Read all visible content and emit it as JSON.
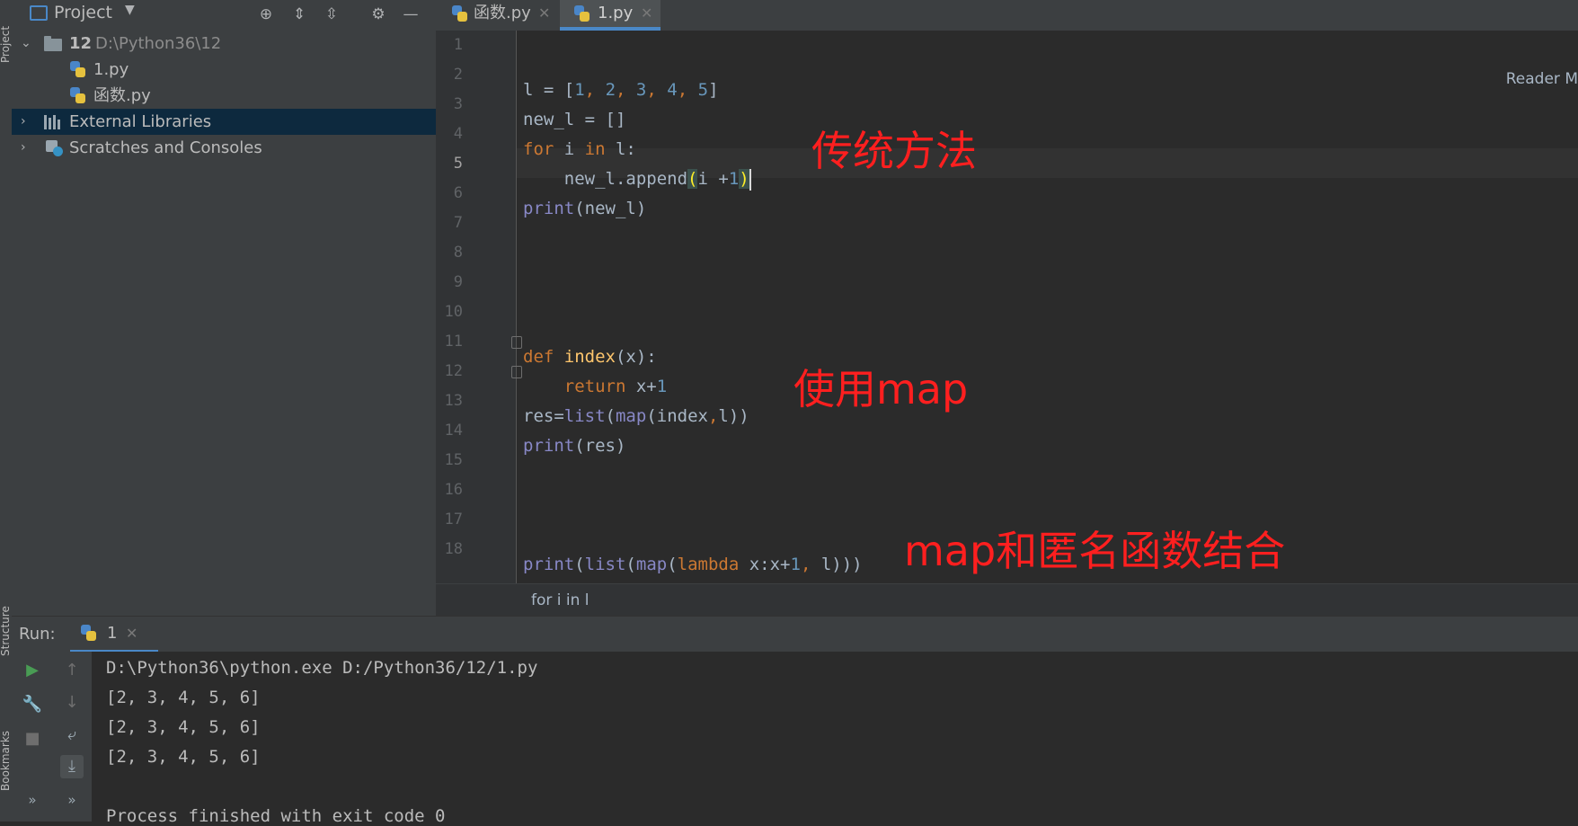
{
  "side_labels": {
    "project": "Project",
    "structure": "Structure",
    "bookmarks": "Bookmarks"
  },
  "project_panel": {
    "title": "Project",
    "tree": [
      {
        "name": "12",
        "path": "D:\\Python36\\12"
      },
      {
        "name": "1.py"
      },
      {
        "name": "函数.py"
      },
      {
        "name": "External Libraries"
      },
      {
        "name": "Scratches and Consoles"
      }
    ]
  },
  "tabs": [
    {
      "label": "函数.py",
      "active": false
    },
    {
      "label": "1.py",
      "active": true
    }
  ],
  "editor": {
    "reader_mode": "Reader M",
    "current_line": 5,
    "line_numbers": [
      "1",
      "2",
      "3",
      "4",
      "5",
      "6",
      "7",
      "8",
      "9",
      "10",
      "11",
      "12",
      "13",
      "14",
      "15",
      "16",
      "17",
      "18"
    ],
    "code_lines": [
      "",
      "l = [1, 2, 3, 4, 5]",
      "new_l = []",
      "for i in l:",
      "    new_l.append(i +1)",
      "print(new_l)",
      "",
      "",
      "",
      "",
      "def index(x):",
      "    return x+1",
      "res=list(map(index,l))",
      "print(res)",
      "",
      "",
      "",
      "print(list(map(lambda x:x+1, l)))"
    ],
    "annotations": [
      "传统方法",
      "使用map",
      "map和匿名函数结合"
    ],
    "breadcrumb": "for i in l"
  },
  "run": {
    "label": "Run:",
    "tab_label": "1",
    "console_lines": [
      "D:\\Python36\\python.exe D:/Python36/12/1.py",
      "[2, 3, 4, 5, 6]",
      "[2, 3, 4, 5, 6]",
      "[2, 3, 4, 5, 6]",
      "",
      "Process finished with exit code 0"
    ]
  }
}
